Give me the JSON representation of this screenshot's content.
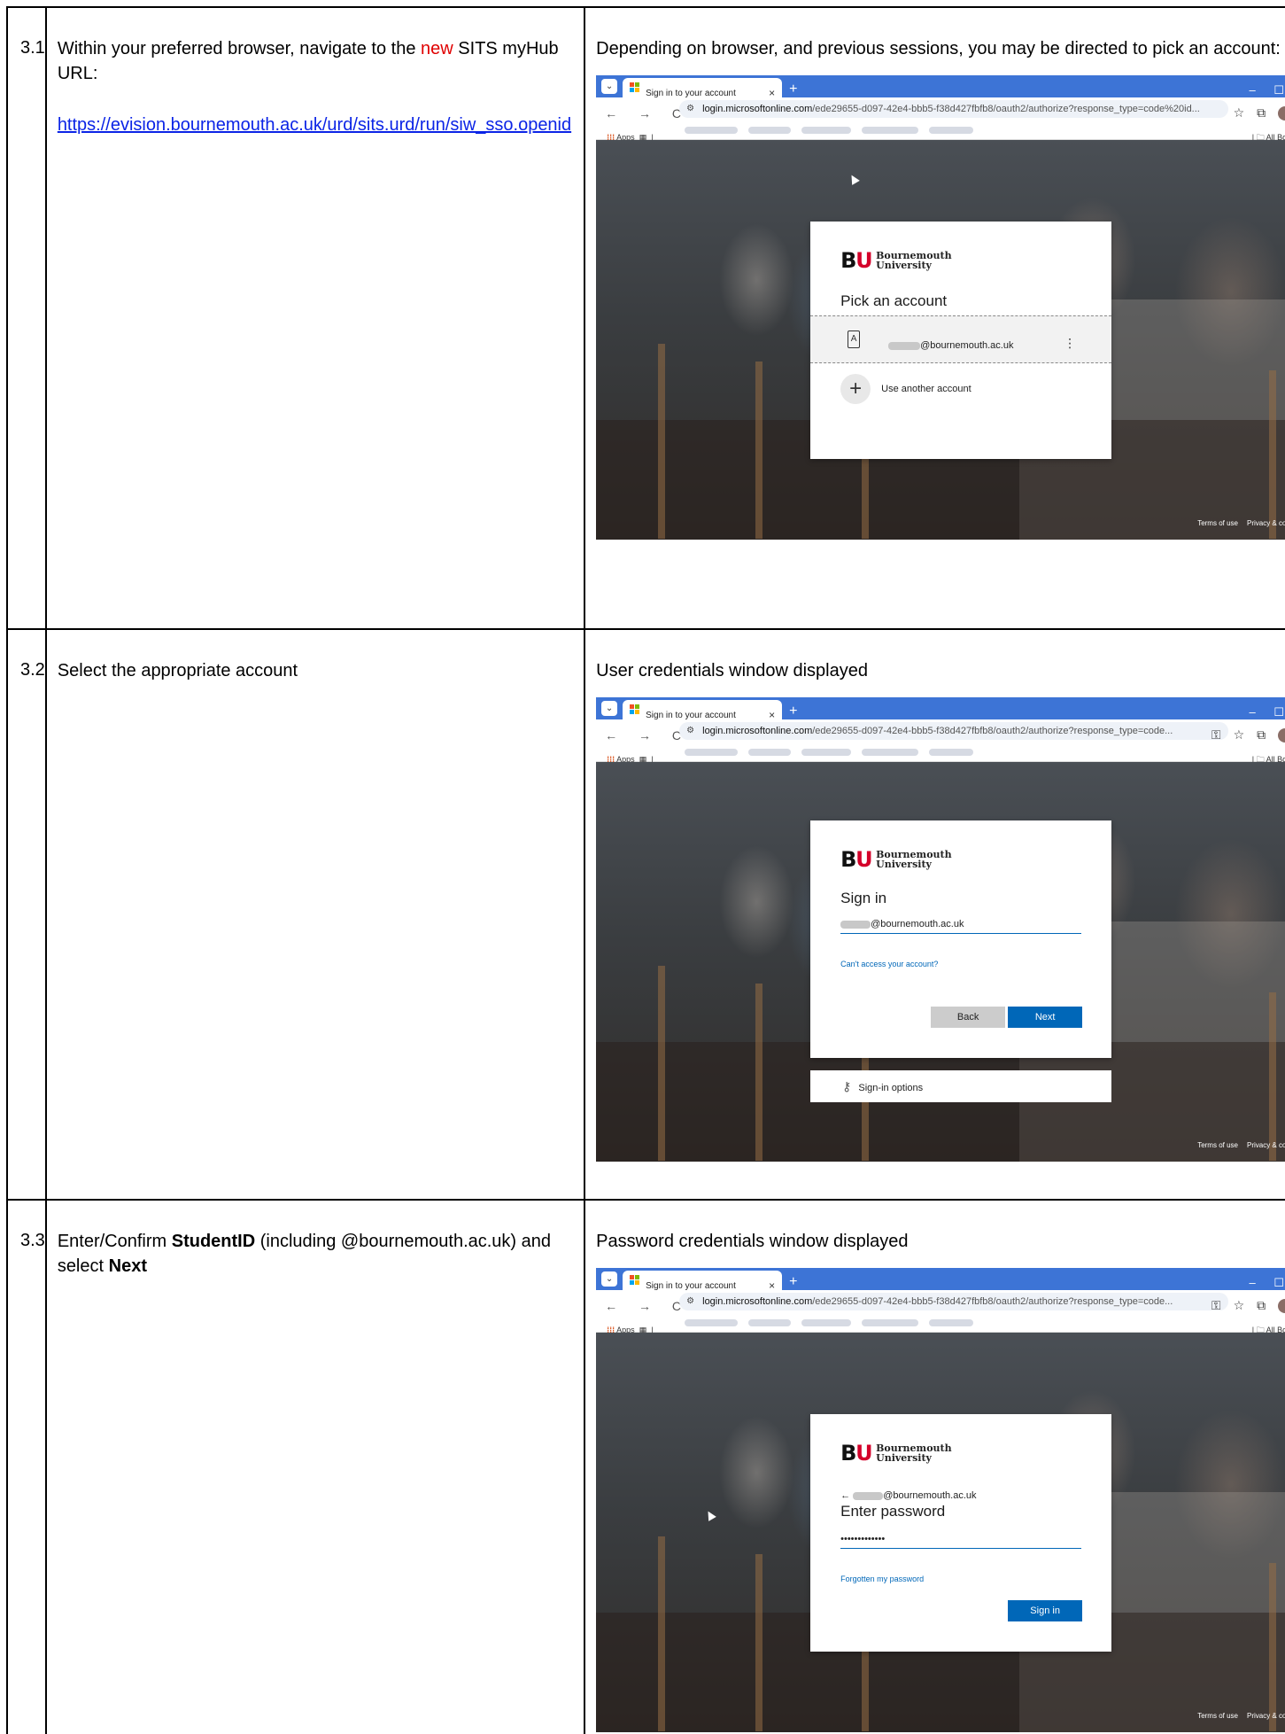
{
  "rows": [
    {
      "number": "3.1",
      "instruction_pre": "Within your preferred browser, navigate to the ",
      "instruction_red": "new",
      "instruction_post": " SITS myHub URL:",
      "link": "https://evision.bournemouth.ac.uk/urd/sits.urd/run/siw_sso.openid",
      "description": "Depending on browser, and previous sessions, you may be directed to pick an account:"
    },
    {
      "number": "3.2",
      "instruction": "Select the appropriate account",
      "description": "User credentials window displayed"
    },
    {
      "number": "3.3",
      "instruction_pre": "Enter/Confirm ",
      "instruction_bold1": "StudentID",
      "instruction_mid": " (including @bournemouth.ac.uk) and select ",
      "instruction_bold2": "Next",
      "description": "Password credentials window displayed"
    }
  ],
  "browser": {
    "tab_title": "Sign in to your account",
    "tab_close": "×",
    "new_tab": "+",
    "win_controls": [
      "–",
      "☐",
      "×"
    ],
    "nav_icons": "← → C",
    "url_domain": "login.microsoftonline.com",
    "url_path_1": "/ede29655-d097-42e4-bbb5-f38d427fbfb8/oauth2/authorize?response_type=code%20id...",
    "url_path_2": "/ede29655-d097-42e4-bbb5-f38d427fbfb8/oauth2/authorize?response_type=code...",
    "bookmarks_apps": "Apps",
    "bookmarks_all": "All Bookmarks",
    "footer_terms": "Terms of use",
    "footer_privacy": "Privacy & cookies",
    "footer_more": "···"
  },
  "brand": {
    "logo_b": "B",
    "logo_u": "U",
    "name_line1": "Bournemouth",
    "name_line2": "University"
  },
  "screen1": {
    "title": "Pick an account",
    "account_email": "@bournemouth.ac.uk",
    "account_menu": "⋮",
    "use_another": "Use another account"
  },
  "screen2": {
    "title": "Sign in",
    "email_value": "@bournemouth.ac.uk",
    "cant_access": "Can't access your account?",
    "back_label": "Back",
    "next_label": "Next",
    "signin_options": "Sign-in options"
  },
  "screen3": {
    "back_arrow": "←",
    "email_value": "@bournemouth.ac.uk",
    "title": "Enter password",
    "password_value": "•••••••••••••",
    "forgot": "Forgotten my password",
    "signin_label": "Sign in"
  },
  "colors": {
    "tab_bar": "#3d74d6",
    "ms_blue": "#0067b8",
    "bu_red": "#d4002a",
    "link_blue": "#0b24e6",
    "new_red": "#e00000"
  }
}
